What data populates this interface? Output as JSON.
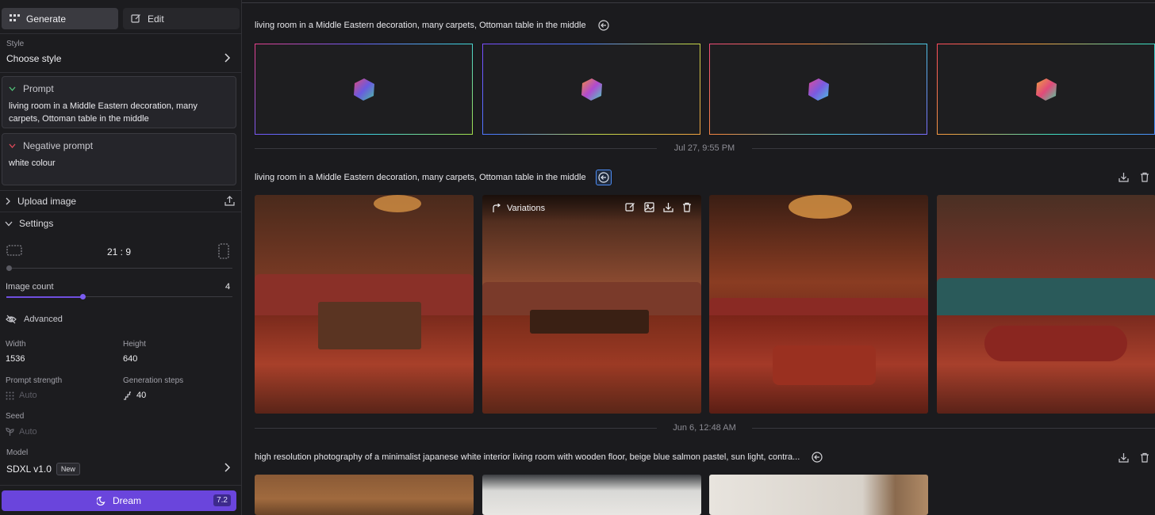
{
  "sidebar": {
    "tabs": [
      {
        "label": "Generate",
        "icon": "grid-icon",
        "active": true
      },
      {
        "label": "Edit",
        "icon": "edit-icon",
        "active": false
      }
    ],
    "style": {
      "label": "Style",
      "value": "Choose style"
    },
    "prompt": {
      "label": "Prompt",
      "text": "living room in a Middle Eastern decoration, many carpets, Ottoman table in the middle"
    },
    "negative_prompt": {
      "label": "Negative prompt",
      "text": "white colour"
    },
    "upload_image": "Upload image",
    "settings": "Settings",
    "aspect_ratio": "21 : 9",
    "image_count": {
      "label": "Image count",
      "value": "4"
    },
    "advanced": "Advanced",
    "width": {
      "label": "Width",
      "value": "1536"
    },
    "height": {
      "label": "Height",
      "value": "640"
    },
    "prompt_strength": {
      "label": "Prompt strength",
      "value": "Auto"
    },
    "generation_steps": {
      "label": "Generation steps",
      "value": "40"
    },
    "seed": {
      "label": "Seed",
      "value": "Auto"
    },
    "model": {
      "label": "Model",
      "value": "SDXL v1.0",
      "badge": "New"
    },
    "dream": {
      "label": "Dream",
      "cost": "7.2"
    },
    "accent_color": "#6a45dc"
  },
  "feed": {
    "group1": {
      "prompt": "living room in a Middle Eastern decoration, many carpets, Ottoman table in the middle"
    },
    "date1": "Jul 27, 9:55 PM",
    "group2": {
      "prompt": "living room in a Middle Eastern decoration, many carpets, Ottoman table in the middle",
      "hover_label": "Variations"
    },
    "date2": "Jun 6, 12:48 AM",
    "group3": {
      "prompt": "high resolution photography of a minimalist japanese white interior living room with wooden floor, beige blue salmon pastel, sun light, contra..."
    }
  }
}
